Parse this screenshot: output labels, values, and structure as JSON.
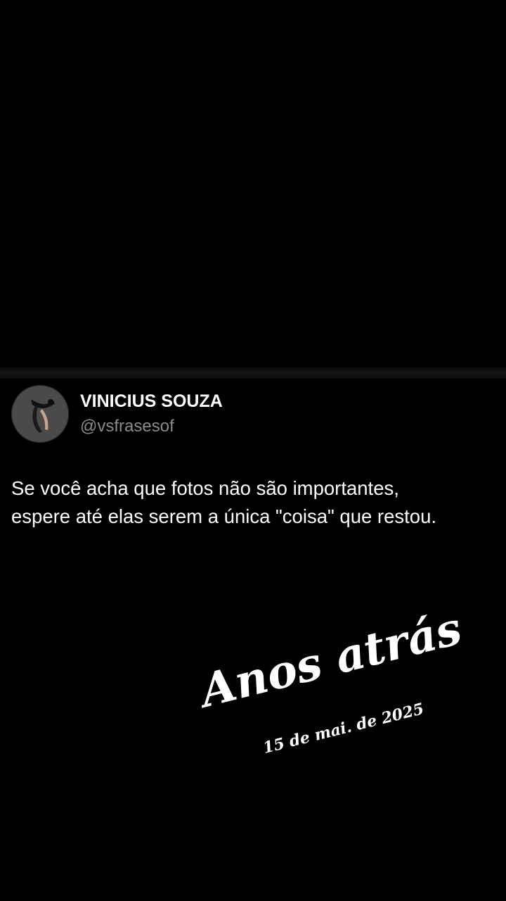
{
  "tweet": {
    "author_name": "VINICIUS SOUZA",
    "author_handle": "@vsfrasesof",
    "text_lines": [
      "Se você acha que fotos não são importantes,",
      "espere até elas serem a única \"coisa\" que restou."
    ]
  },
  "sticker": {
    "title": "Anos atrás",
    "date": "15 de mai. de 2025"
  },
  "colors": {
    "background": "#000000",
    "text": "#ffffff",
    "handle": "#8b8b8b"
  }
}
